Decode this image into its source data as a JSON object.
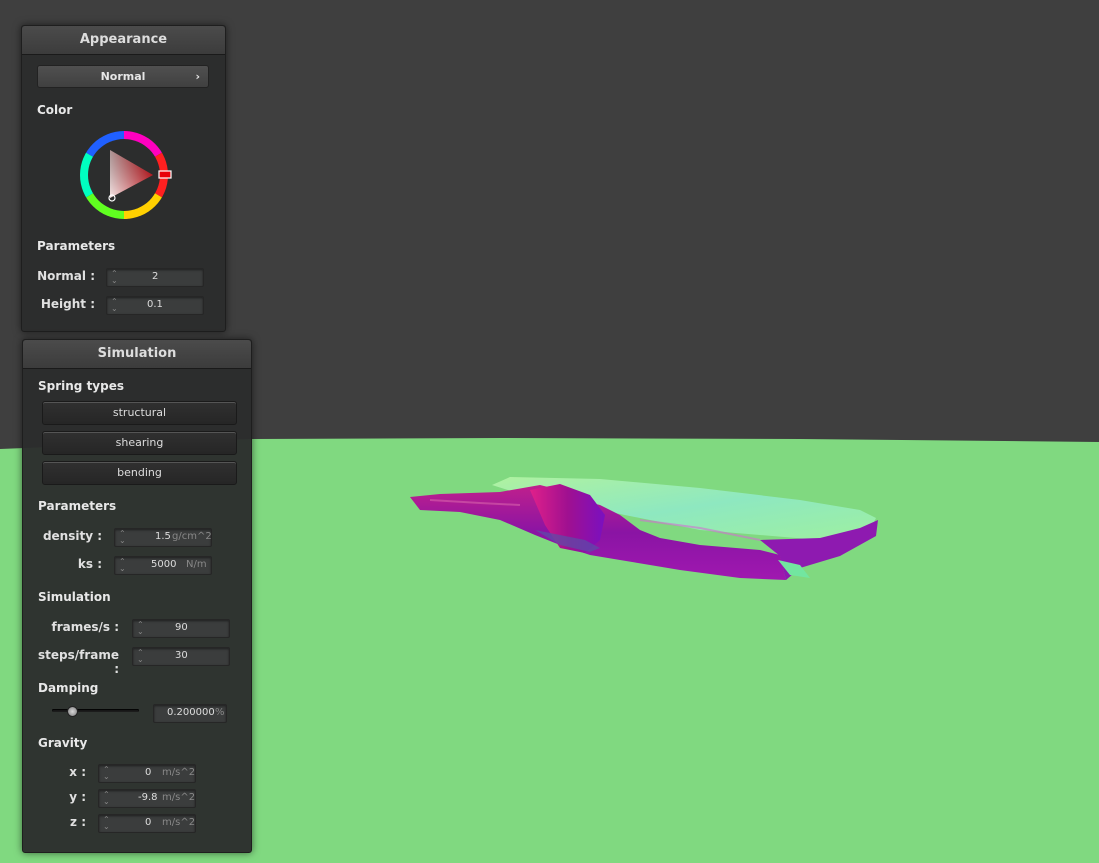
{
  "appearance": {
    "title": "Appearance",
    "mode": "Normal",
    "color_label": "Color",
    "parameters_label": "Parameters",
    "normal_label": "Normal :",
    "normal_value": "2",
    "height_label": "Height :",
    "height_value": "0.1",
    "selected_color": "#e8000a"
  },
  "simulation": {
    "title": "Simulation",
    "spring_types_label": "Spring types",
    "spring_buttons": [
      "structural",
      "shearing",
      "bending"
    ],
    "parameters_label": "Parameters",
    "density_label": "density :",
    "density_value": "1.5",
    "density_unit": "g/cm^2",
    "ks_label": "ks :",
    "ks_value": "5000",
    "ks_unit": "N/m",
    "simulation_label": "Simulation",
    "fps_label": "frames/s :",
    "fps_value": "90",
    "steps_label": "steps/frame :",
    "steps_value": "30",
    "damping_label": "Damping",
    "damping_value": "0.200000",
    "damping_unit": "%",
    "damping_fraction": 0.2,
    "gravity_label": "Gravity",
    "gravity_x_label": "x :",
    "gravity_x_value": "0",
    "gravity_y_label": "y :",
    "gravity_y_value": "-9.8",
    "gravity_z_label": "z :",
    "gravity_z_value": "0",
    "gravity_unit": "m/s^2"
  },
  "scene": {
    "background_color": "#3f3f3f",
    "ground_color": "#80d980"
  }
}
